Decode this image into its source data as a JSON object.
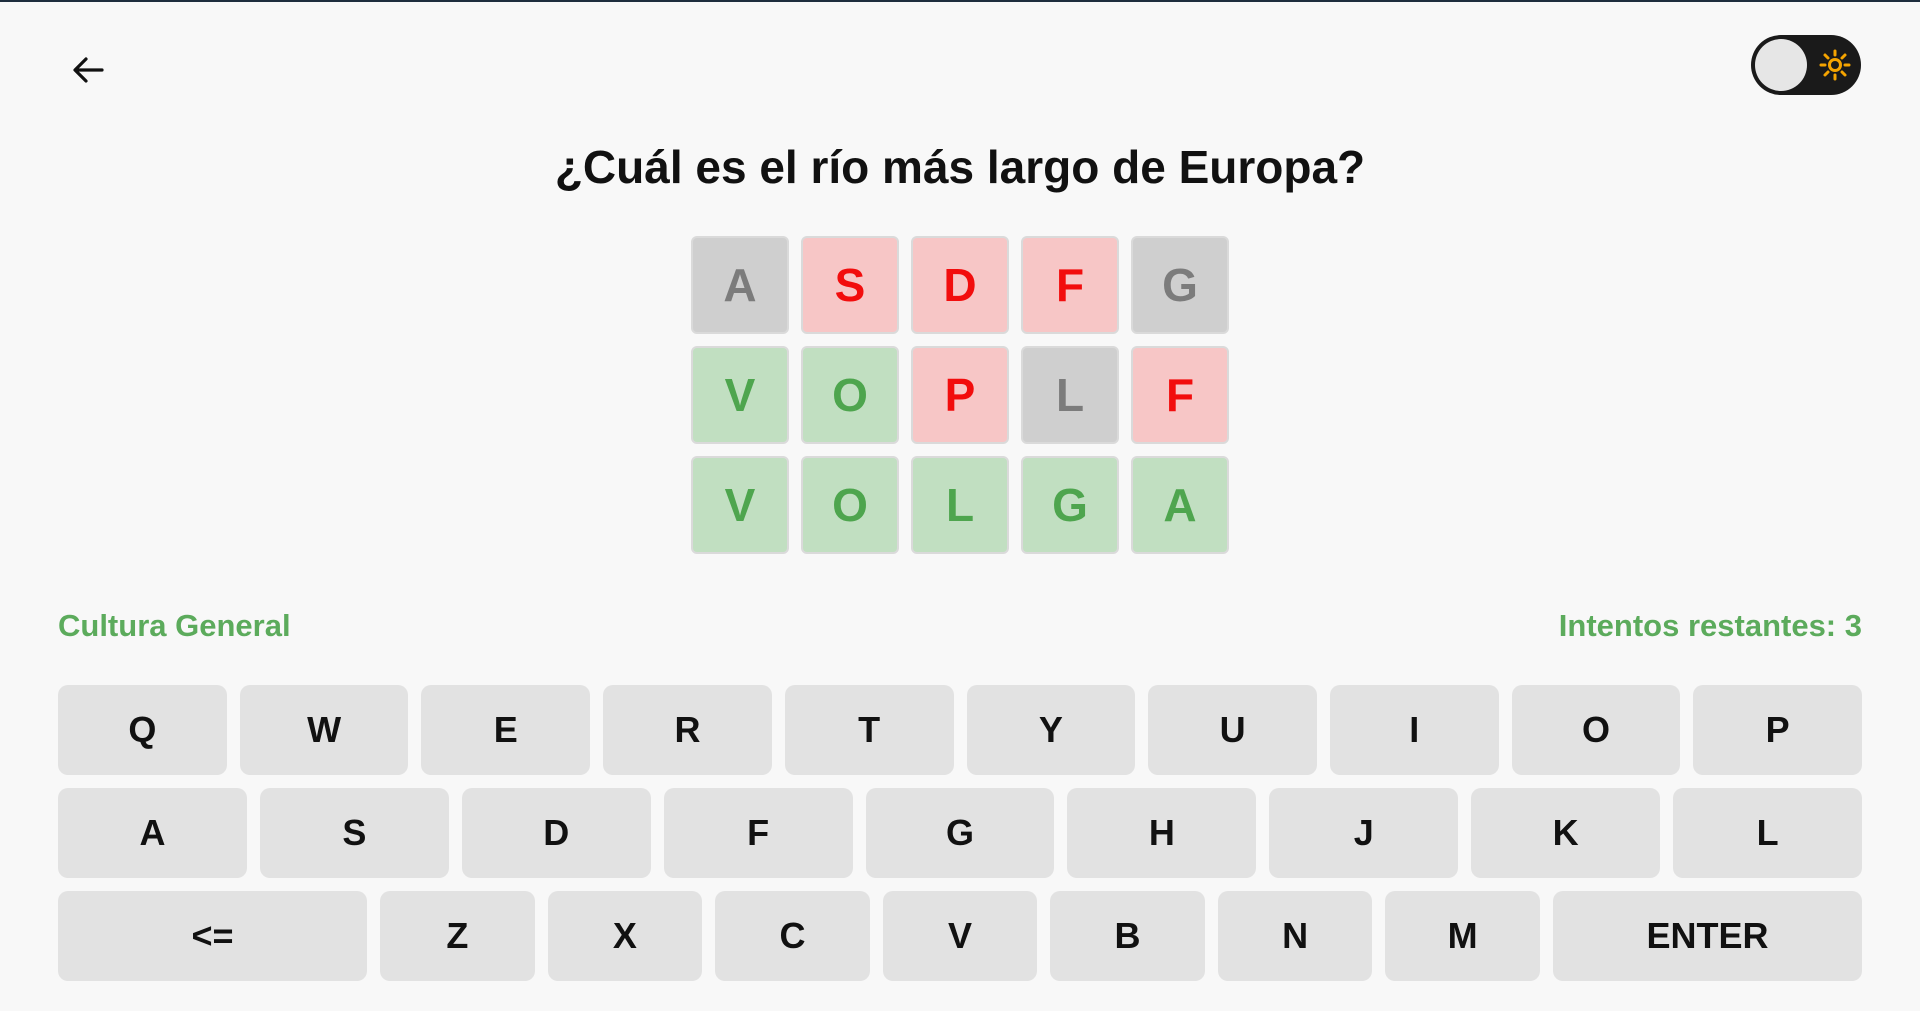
{
  "header": {
    "back_icon": "arrow-left-icon",
    "theme_icon": "sun-icon",
    "theme_accent": "#f5a400"
  },
  "question": "¿Cuál es el río más largo de Europa?",
  "board": {
    "rows": [
      [
        {
          "letter": "A",
          "state": "absent"
        },
        {
          "letter": "S",
          "state": "wrong"
        },
        {
          "letter": "D",
          "state": "wrong"
        },
        {
          "letter": "F",
          "state": "wrong"
        },
        {
          "letter": "G",
          "state": "absent"
        }
      ],
      [
        {
          "letter": "V",
          "state": "correct"
        },
        {
          "letter": "O",
          "state": "correct"
        },
        {
          "letter": "P",
          "state": "wrong"
        },
        {
          "letter": "L",
          "state": "absent"
        },
        {
          "letter": "F",
          "state": "wrong"
        }
      ],
      [
        {
          "letter": "V",
          "state": "correct"
        },
        {
          "letter": "O",
          "state": "correct"
        },
        {
          "letter": "L",
          "state": "correct"
        },
        {
          "letter": "G",
          "state": "correct"
        },
        {
          "letter": "A",
          "state": "correct"
        }
      ]
    ],
    "colors": {
      "correct": "#4ea54e",
      "wrong": "#f20d0d",
      "absent": "#7c7c7c"
    }
  },
  "status": {
    "category": "Cultura General",
    "attempts": "Intentos restantes: 3",
    "color": "#5cab5c"
  },
  "keyboard": {
    "rows": [
      [
        "Q",
        "W",
        "E",
        "R",
        "T",
        "Y",
        "U",
        "I",
        "O",
        "P"
      ],
      [
        "A",
        "S",
        "D",
        "F",
        "G",
        "H",
        "J",
        "K",
        "L"
      ],
      [
        "<=",
        "Z",
        "X",
        "C",
        "V",
        "B",
        "N",
        "M",
        "ENTER"
      ]
    ]
  }
}
